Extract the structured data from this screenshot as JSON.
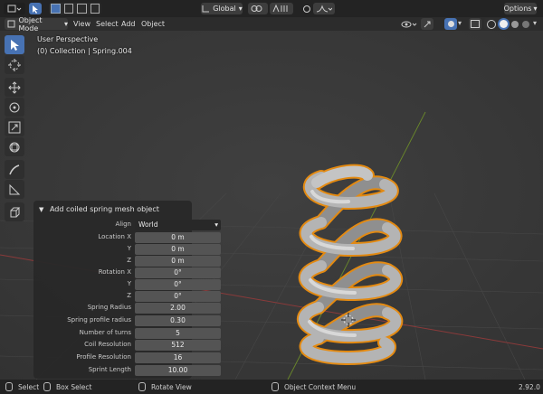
{
  "topbar": {
    "transform_orientation": "Global",
    "options_label": "Options"
  },
  "header": {
    "mode_label": "Object Mode",
    "menus": [
      "View",
      "Select",
      "Add",
      "Object"
    ]
  },
  "viewport": {
    "perspective_label": "User Perspective",
    "collection_label": "(0) Collection | Spring.004",
    "version": "2.92.0"
  },
  "operator_panel": {
    "title": "Add coiled spring mesh object",
    "align": {
      "label": "Align",
      "value": "World"
    },
    "location": {
      "labels": [
        "Location X",
        "Y",
        "Z"
      ],
      "values": [
        "0 m",
        "0 m",
        "0 m"
      ]
    },
    "rotation": {
      "labels": [
        "Rotation X",
        "Y",
        "Z"
      ],
      "values": [
        "0°",
        "0°",
        "0°"
      ]
    },
    "params": [
      {
        "label": "Spring Radius",
        "value": "2.00"
      },
      {
        "label": "Spring profile radius",
        "value": "0.30"
      },
      {
        "label": "Number of turns",
        "value": "5"
      },
      {
        "label": "Coil Resolution",
        "value": "512"
      },
      {
        "label": "Profile Resolution",
        "value": "16"
      },
      {
        "label": "Sprint Length",
        "value": "10.00"
      }
    ]
  },
  "statusbar": {
    "select": "Select",
    "box_select": "Box Select",
    "rotate_view": "Rotate View",
    "context_menu": "Object Context Menu"
  },
  "colors": {
    "accent": "#4772b3",
    "selection_outline": "#e38a12",
    "axis_x": "#8a3a3a",
    "axis_y": "#6b8a2a"
  }
}
